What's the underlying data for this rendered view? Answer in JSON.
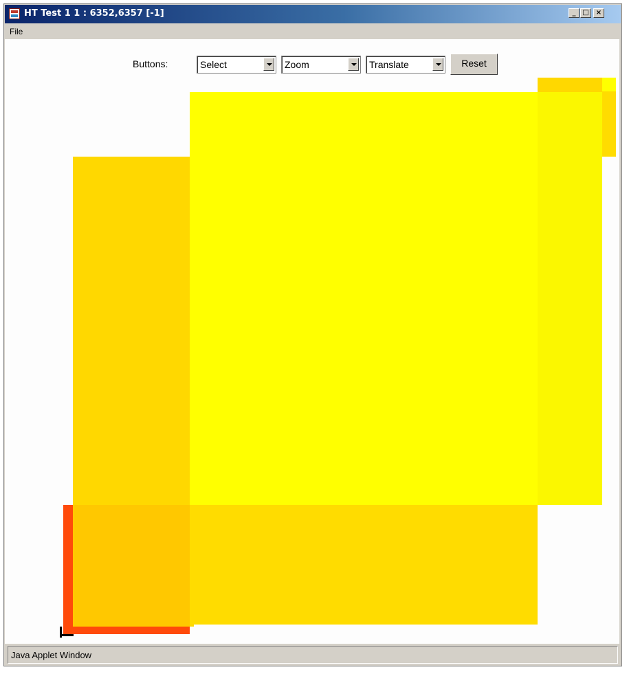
{
  "window": {
    "title": "HT Test 1 1 : 6352,6357 [-1]",
    "controls": {
      "minimize": "_",
      "maximize": "□",
      "close": "×"
    }
  },
  "menu": {
    "file_label": "File"
  },
  "toolbar": {
    "label": "Buttons:",
    "select_value": "Select",
    "zoom_value": "Zoom",
    "translate_value": "Translate",
    "reset_label": "Reset"
  },
  "status": {
    "text": "Java Applet Window"
  },
  "colors": {
    "red": "#ff4a0a",
    "orange": "#ffc800",
    "gold": "#ffd800",
    "yellow": "#ffff00"
  }
}
